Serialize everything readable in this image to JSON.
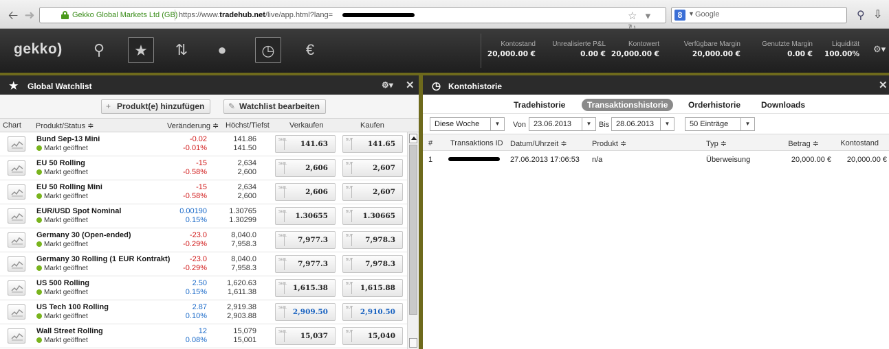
{
  "browser": {
    "site_identity": "Gekko Global Markets Ltd (GB)",
    "url_prefix": "https://www.",
    "url_host": "tradehub.net",
    "url_path": "/live/app.html?lang=",
    "search_placeholder": "Google",
    "search_engine_letter": "8"
  },
  "app": {
    "logo": "gekko)",
    "toolbar_icons": [
      "search-icon",
      "star-icon",
      "sort-arrows-icon",
      "lightbulb-icon",
      "clock-icon",
      "euro-icon"
    ],
    "account": [
      {
        "label": "Kontostand",
        "value": "20,000.00 €"
      },
      {
        "label": "Unrealisierte P&L",
        "value": "0.00 €"
      },
      {
        "label": "Kontowert",
        "value": "20,000.00 €"
      },
      {
        "label": "Verfügbare Margin",
        "value": "20,000.00 €"
      },
      {
        "label": "Genutzte Margin",
        "value": "0.00 €"
      },
      {
        "label": "Liquidität",
        "value": "100.00%"
      }
    ]
  },
  "watchlist": {
    "title": "Global Watchlist",
    "add_button": "Produkt(e) hinzufügen",
    "edit_button": "Watchlist bearbeiten",
    "columns": {
      "chart": "Chart",
      "product": "Produkt/Status ≑",
      "change": "Veränderung ≑",
      "highlow": "Höchst/Tiefst",
      "sell": "Verkaufen",
      "buy": "Kaufen"
    },
    "sell_tag": "SELL",
    "buy_tag": "BUY",
    "rows": [
      {
        "name": "Bund Sep-13 Mini",
        "status": "Markt geöffnet",
        "change": "-0.02",
        "change_pct": "-0.01%",
        "dir": "neg",
        "high": "141.86",
        "low": "141.50",
        "sell": "141.63",
        "buy": "141.65",
        "price_blue": false
      },
      {
        "name": "EU 50 Rolling",
        "status": "Markt geöffnet",
        "change": "-15",
        "change_pct": "-0.58%",
        "dir": "neg",
        "high": "2,634",
        "low": "2,600",
        "sell": "2,606",
        "buy": "2,607",
        "price_blue": false
      },
      {
        "name": "EU 50 Rolling Mini",
        "status": "Markt geöffnet",
        "change": "-15",
        "change_pct": "-0.58%",
        "dir": "neg",
        "high": "2,634",
        "low": "2,600",
        "sell": "2,606",
        "buy": "2,607",
        "price_blue": false
      },
      {
        "name": "EUR/USD Spot Nominal",
        "status": "Markt geöffnet",
        "change": "0.00190",
        "change_pct": "0.15%",
        "dir": "pos",
        "high": "1.30765",
        "low": "1.30299",
        "sell": "1.30655",
        "buy": "1.30665",
        "price_blue": false
      },
      {
        "name": "Germany 30 (Open-ended)",
        "status": "Markt geöffnet",
        "change": "-23.0",
        "change_pct": "-0.29%",
        "dir": "neg",
        "high": "8,040.0",
        "low": "7,958.3",
        "sell": "7,977.3",
        "buy": "7,978.3",
        "price_blue": false
      },
      {
        "name": "Germany 30 Rolling (1 EUR Kontrakt)",
        "status": "Markt geöffnet",
        "change": "-23.0",
        "change_pct": "-0.29%",
        "dir": "neg",
        "high": "8,040.0",
        "low": "7,958.3",
        "sell": "7,977.3",
        "buy": "7,978.3",
        "price_blue": false
      },
      {
        "name": "US 500 Rolling",
        "status": "Markt geöffnet",
        "change": "2.50",
        "change_pct": "0.15%",
        "dir": "pos",
        "high": "1,620.63",
        "low": "1,611.38",
        "sell": "1,615.38",
        "buy": "1,615.88",
        "price_blue": false
      },
      {
        "name": "US Tech 100 Rolling",
        "status": "Markt geöffnet",
        "change": "2.87",
        "change_pct": "0.10%",
        "dir": "pos",
        "high": "2,919.38",
        "low": "2,903.88",
        "sell": "2,909.50",
        "buy": "2,910.50",
        "price_blue": true
      },
      {
        "name": "Wall Street Rolling",
        "status": "Markt geöffnet",
        "change": "12",
        "change_pct": "0.08%",
        "dir": "pos",
        "high": "15,079",
        "low": "15,001",
        "sell": "15,037",
        "buy": "15,040",
        "price_blue": false
      }
    ]
  },
  "history": {
    "title": "Kontohistorie",
    "tabs": [
      "Tradehistorie",
      "Transaktionshistorie",
      "Orderhistorie",
      "Downloads"
    ],
    "active_tab": 1,
    "filters": {
      "period": "Diese Woche",
      "from_label": "Von",
      "from": "23.06.2013",
      "to_label": "Bis",
      "to": "28.06.2013",
      "entries": "50 Einträge"
    },
    "columns": {
      "num": "#",
      "id": "Transaktions ID",
      "datetime": "Datum/Uhrzeit ≑",
      "product": "Produkt ≑",
      "type": "Typ ≑",
      "amount": "Betrag ≑",
      "balance": "Kontostand"
    },
    "rows": [
      {
        "num": "1",
        "datetime": "27.06.2013 17:06:53",
        "product": "n/a",
        "type": "Überweisung",
        "amount": "20,000.00 €",
        "balance": "20,000.00 €"
      }
    ]
  },
  "colors": {
    "toolbar": "#2a2a2a",
    "divider": "#6e6a1c",
    "negative": "#d11a1a",
    "positive": "#1a6ac9",
    "status_dot": "#79b41e"
  }
}
